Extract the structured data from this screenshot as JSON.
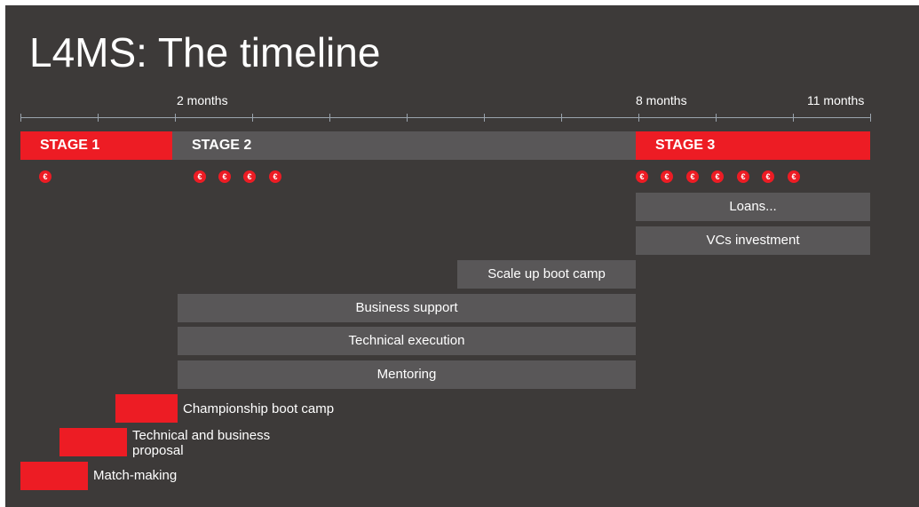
{
  "title": "L4MS: The timeline",
  "axis": {
    "labels": [
      "2 months",
      "8 months",
      "11 months"
    ]
  },
  "stages": [
    "STAGE 1",
    "STAGE 2",
    "STAGE 3"
  ],
  "coin_symbol": "€",
  "stage1_coin_count": 1,
  "stage2_coin_count": 4,
  "stage3_coin_count": 7,
  "bars": {
    "loans": "Loans...",
    "vcs": "VCs investment",
    "scaleup": "Scale up boot camp",
    "business_support": "Business support",
    "technical_execution": "Technical execution",
    "mentoring": "Mentoring"
  },
  "steps": {
    "championship": "Championship boot camp",
    "proposal_line1": "Technical and business",
    "proposal_line2": "proposal",
    "matchmaking": "Match-making"
  },
  "colors": {
    "background": "#3d3a39",
    "accent_red": "#ed1c24",
    "bar_gray": "#595758",
    "text": "#ffffff"
  }
}
